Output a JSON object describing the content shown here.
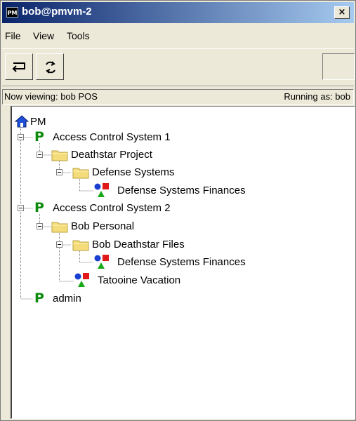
{
  "window": {
    "app_badge": "PM",
    "title": "bob@pmvm-2",
    "close_glyph": "×"
  },
  "menu": {
    "items": [
      {
        "label": "File"
      },
      {
        "label": "View"
      },
      {
        "label": "Tools"
      }
    ]
  },
  "toolbar": {
    "buttons": [
      {
        "icon": "return-arrow-icon"
      },
      {
        "icon": "refresh-icon"
      }
    ]
  },
  "status": {
    "left": "Now viewing: bob POS",
    "right": "Running as: bob"
  },
  "tree": {
    "root": "PM",
    "nodes": [
      {
        "label": "Access Control System 1",
        "type": "policy"
      },
      {
        "label": "Deathstar Project",
        "type": "folder"
      },
      {
        "label": "Defense Systems",
        "type": "folder"
      },
      {
        "label": "Defense Systems Finances",
        "type": "object"
      },
      {
        "label": "Access Control System 2",
        "type": "policy"
      },
      {
        "label": "Bob Personal",
        "type": "folder"
      },
      {
        "label": "Bob Deathstar Files",
        "type": "folder"
      },
      {
        "label": "Defense Systems Finances",
        "type": "object"
      },
      {
        "label": "Tatooine Vacation",
        "type": "object"
      },
      {
        "label": "admin",
        "type": "policy"
      }
    ]
  },
  "colors": {
    "title_gradient_start": "#0a246a",
    "title_gradient_end": "#a6caf0",
    "policy_green": "#0b8a0b",
    "folder_yellow": "#f5dc7a"
  }
}
